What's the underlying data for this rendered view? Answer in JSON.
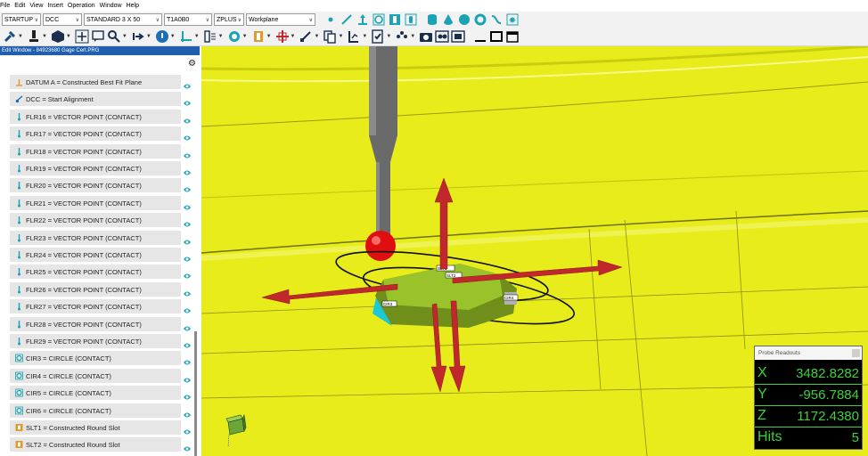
{
  "menu": [
    "File",
    "Edit",
    "View",
    "Insert",
    "Operation",
    "Window",
    "Help"
  ],
  "toolbar": {
    "combos": [
      {
        "value": "STARTUP"
      },
      {
        "value": "DCC"
      },
      {
        "value": "STANDARD 3 X 50"
      },
      {
        "value": "T1A0B0"
      },
      {
        "value": "ZPLUS"
      },
      {
        "value": "Workplane"
      }
    ]
  },
  "edit_window": {
    "title": "Edit Window - 84923680 Gage Cert.PRG",
    "items": [
      {
        "label": "DATUM A = Constructed Best Fit Plane",
        "icon": "plane-icon"
      },
      {
        "label": "DCC = Start Alignment",
        "icon": "alignment-icon"
      },
      {
        "label": "FLR16 = VECTOR POINT (CONTACT)",
        "icon": "vector-point-icon"
      },
      {
        "label": "FLR17 = VECTOR POINT (CONTACT)",
        "icon": "vector-point-icon"
      },
      {
        "label": "FLR18 = VECTOR POINT (CONTACT)",
        "icon": "vector-point-icon"
      },
      {
        "label": "FLR19 = VECTOR POINT (CONTACT)",
        "icon": "vector-point-icon"
      },
      {
        "label": "FLR20 = VECTOR POINT (CONTACT)",
        "icon": "vector-point-icon"
      },
      {
        "label": "FLR21 = VECTOR POINT (CONTACT)",
        "icon": "vector-point-icon"
      },
      {
        "label": "FLR22 = VECTOR POINT (CONTACT)",
        "icon": "vector-point-icon"
      },
      {
        "label": "FLR23 = VECTOR POINT (CONTACT)",
        "icon": "vector-point-icon"
      },
      {
        "label": "FLR24 = VECTOR POINT (CONTACT)",
        "icon": "vector-point-icon"
      },
      {
        "label": "FLR25 = VECTOR POINT (CONTACT)",
        "icon": "vector-point-icon"
      },
      {
        "label": "FLR26 = VECTOR POINT (CONTACT)",
        "icon": "vector-point-icon"
      },
      {
        "label": "FLR27 = VECTOR POINT (CONTACT)",
        "icon": "vector-point-icon"
      },
      {
        "label": "FLR28 = VECTOR POINT (CONTACT)",
        "icon": "vector-point-icon"
      },
      {
        "label": "FLR29 = VECTOR POINT (CONTACT)",
        "icon": "vector-point-icon"
      },
      {
        "label": "CIR3 = CIRCLE (CONTACT)",
        "icon": "circle-feature-icon"
      },
      {
        "label": "CIR4 = CIRCLE (CONTACT)",
        "icon": "circle-feature-icon"
      },
      {
        "label": "CIR5 = CIRCLE (CONTACT)",
        "icon": "circle-feature-icon"
      },
      {
        "label": "CIR6 = CIRCLE (CONTACT)",
        "icon": "circle-feature-icon"
      },
      {
        "label": "SLT1 = Constructed Round Slot",
        "icon": "slot-icon"
      },
      {
        "label": "SLT2 = Constructed Round Slot",
        "icon": "slot-icon"
      }
    ]
  },
  "viewport": {
    "labels": [
      "SLT1",
      "SLT2",
      "CIR3",
      "CIR4"
    ]
  },
  "probe_readouts": {
    "title": "Probe Readouts",
    "x_label": "X",
    "x_value": "3482.8282",
    "y_label": "Y",
    "y_value": "-956.7884",
    "z_label": "Z",
    "z_value": "1172.4380",
    "hits_label": "Hits",
    "hits_value": "5"
  },
  "colors": {
    "part_yellow": "#e7ec1a",
    "arrow_red": "#c0282b",
    "readout_green": "#3fcf3f",
    "title_blue": "#1f5fae"
  }
}
